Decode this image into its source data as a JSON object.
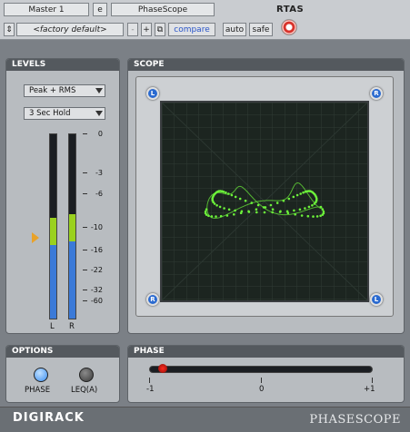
{
  "host": {
    "track_name": "Master 1",
    "insert_slot": "e",
    "plugin_name": "PhaseScope",
    "format": "RTAS",
    "preset_stepper": "⇕",
    "preset_name": "<factory default>",
    "preset_minus": "-",
    "preset_plus": "+",
    "copy_icon": "⧉",
    "compare_label": "compare",
    "auto_label": "auto",
    "safe_label": "safe",
    "power_icon": "power-icon"
  },
  "levels": {
    "title": "LEVELS",
    "mode": "Peak + RMS",
    "hold": "3 Sec Hold",
    "scale": [
      "0",
      "-3",
      "-6",
      "-10",
      "-16",
      "-22",
      "-32",
      "-60"
    ],
    "left_label": "L",
    "right_label": "R",
    "left_level_fraction": 0.4,
    "right_level_fraction": 0.42,
    "left_hold_fraction": 0.55,
    "right_hold_fraction": 0.57
  },
  "scope": {
    "title": "SCOPE",
    "corner_tl": "L",
    "corner_tr": "R",
    "corner_bl": "R",
    "corner_br": "L"
  },
  "options": {
    "title": "OPTIONS",
    "phase_label": "PHASE",
    "leq_label": "LEQ(A)",
    "phase_on": true,
    "leq_on": false
  },
  "phase": {
    "title": "PHASE",
    "min_label": "-1",
    "mid_label": "0",
    "max_label": "+1",
    "value": -0.92
  },
  "footer": {
    "brand_left": "DIGIRACK",
    "brand_right": "PHASESCOPE"
  },
  "colors": {
    "meter_blue": "#3b7ad8",
    "meter_green": "#9ad11e",
    "scope_trace": "#6cf23a",
    "led_on": "#3c8ef0",
    "led_off": "#3a3a3a"
  }
}
